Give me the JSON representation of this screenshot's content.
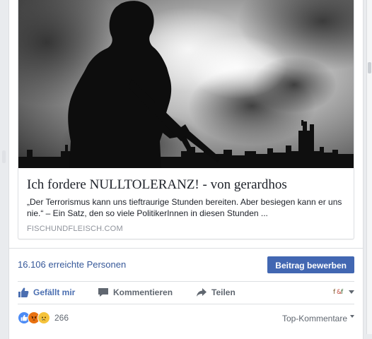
{
  "post": {
    "link_preview": {
      "title": "Ich fordere NULLTOLERANZ! - von gerardhos",
      "description": "„Der Terrorismus kann uns tieftraurige Stunden bereiten. Aber besiegen kann er uns nie.“ – Ein Satz, den so viele PolitikerInnen in diesen Stunden ...",
      "domain": "FISCHUNDFLEISCH.COM",
      "image_icon": "silhouette-soldier-city-smoke-image"
    },
    "insights": {
      "reach_text": "16.106 erreichte Personen",
      "boost_label": "Beitrag bewerben"
    },
    "actions": {
      "like_label": "Gefällt mir",
      "comment_label": "Kommentieren",
      "share_label": "Teilen",
      "viewer_icon": "page-avatar-icon"
    },
    "reactions": {
      "types": [
        "like",
        "angry",
        "sad"
      ],
      "count": "266",
      "sort_label": "Top-Kommentare"
    }
  },
  "colors": {
    "accent": "#4267b2",
    "link_blue": "#365899",
    "like_blue": "#4b6fb1",
    "muted": "#606770",
    "border": "#dddfe2"
  }
}
